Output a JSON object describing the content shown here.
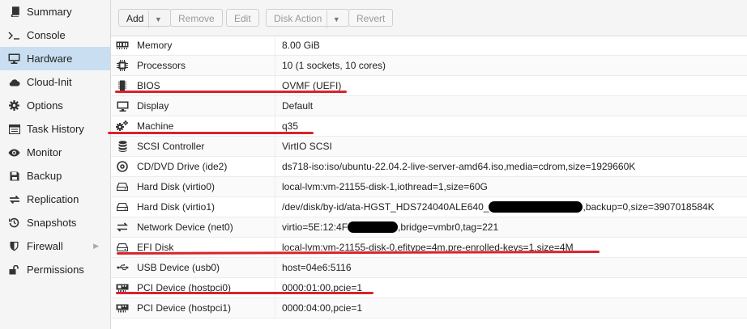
{
  "sidebar": {
    "items": [
      {
        "label": "Summary",
        "icon": "book-icon"
      },
      {
        "label": "Console",
        "icon": "terminal-icon"
      },
      {
        "label": "Hardware",
        "icon": "monitor-icon",
        "selected": true
      },
      {
        "label": "Cloud-Init",
        "icon": "cloud-icon"
      },
      {
        "label": "Options",
        "icon": "gear-icon"
      },
      {
        "label": "Task History",
        "icon": "list-icon"
      },
      {
        "label": "Monitor",
        "icon": "eye-icon"
      },
      {
        "label": "Backup",
        "icon": "floppy-icon"
      },
      {
        "label": "Replication",
        "icon": "sync-icon"
      },
      {
        "label": "Snapshots",
        "icon": "history-icon"
      },
      {
        "label": "Firewall",
        "icon": "shield-icon",
        "has_submenu": true
      },
      {
        "label": "Permissions",
        "icon": "unlock-icon"
      }
    ]
  },
  "toolbar": {
    "add_label": "Add",
    "remove_label": "Remove",
    "edit_label": "Edit",
    "disk_action_label": "Disk Action",
    "revert_label": "Revert"
  },
  "hardware": [
    {
      "name": "Memory",
      "value": "8.00 GiB",
      "icon": "memory-icon"
    },
    {
      "name": "Processors",
      "value": "10 (1 sockets, 10 cores)",
      "icon": "cpu-icon"
    },
    {
      "name": "BIOS",
      "value": "OVMF (UEFI)",
      "icon": "bios-chip-icon"
    },
    {
      "name": "Display",
      "value": "Default",
      "icon": "desktop-icon"
    },
    {
      "name": "Machine",
      "value": "q35",
      "icon": "cogs-icon"
    },
    {
      "name": "SCSI Controller",
      "value": "VirtIO SCSI",
      "icon": "database-icon"
    },
    {
      "name": "CD/DVD Drive (ide2)",
      "value": "ds718-iso:iso/ubuntu-22.04.2-live-server-amd64.iso,media=cdrom,size=1929660K",
      "icon": "cdrom-icon"
    },
    {
      "name": "Hard Disk (virtio0)",
      "value": "local-lvm:vm-21155-disk-1,iothread=1,size=60G",
      "icon": "harddisk-icon"
    },
    {
      "name": "Hard Disk (virtio1)",
      "value_prefix": "/dev/disk/by-id/ata-HGST_HDS724040ALE640_",
      "value_suffix": ",backup=0,size=3907018584K",
      "icon": "harddisk-icon"
    },
    {
      "name": "Network Device (net0)",
      "value_prefix": "virtio=5E:12:4F",
      "value_suffix": ",bridge=vmbr0,tag=221",
      "icon": "exchange-icon"
    },
    {
      "name": "EFI Disk",
      "value": "local-lvm:vm-21155-disk-0,efitype=4m,pre-enrolled-keys=1,size=4M",
      "icon": "harddisk-icon"
    },
    {
      "name": "USB Device (usb0)",
      "value": "host=04e6:5116",
      "icon": "usb-icon"
    },
    {
      "name": "PCI Device (hostpci0)",
      "value": "0000:01:00,pcie=1",
      "icon": "pci-card-icon"
    },
    {
      "name": "PCI Device (hostpci1)",
      "value": "0000:04:00,pcie=1",
      "icon": "pci-card-icon"
    }
  ],
  "colors": {
    "selected_nav": "#c9dff1",
    "annotation_red": "#d9232d",
    "redaction": "#000000"
  }
}
